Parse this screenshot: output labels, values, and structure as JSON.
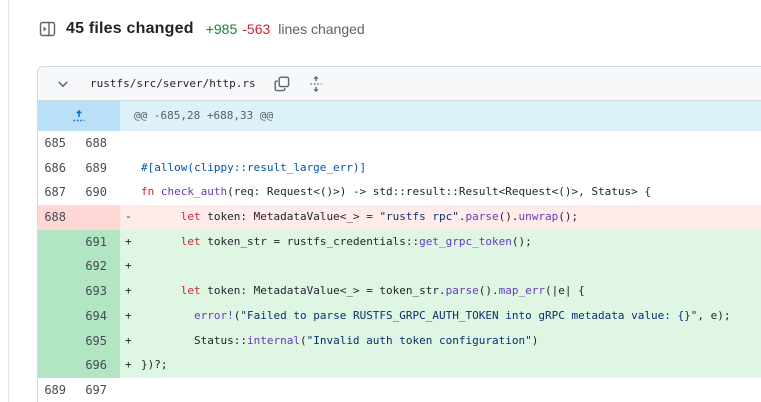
{
  "header": {
    "files_changed": "45 files changed",
    "additions": "+985",
    "deletions": "-563",
    "suffix": "lines changed"
  },
  "file": {
    "path": "rustfs/src/server/http.rs"
  },
  "colors": {
    "addition_text": "#1a7f37",
    "deletion_text": "#cf222e",
    "addition_line_bg": "#dff6e5",
    "addition_num_bg": "#b2e5c1",
    "deletion_line_bg": "#ffebe9",
    "deletion_num_bg": "#ffd7d5",
    "hunk_line_bg": "#ddf1fb",
    "hunk_num_bg": "#b9e0f7",
    "accent_blue": "#0969da"
  },
  "diff": {
    "hunk": "@@ -685,28 +688,33 @@",
    "rows": [
      {
        "old": "685",
        "new": "688",
        "type": "context",
        "marker": "",
        "code": []
      },
      {
        "old": "686",
        "new": "689",
        "type": "context",
        "marker": "",
        "code": [
          {
            "t": "#[allow(clippy::result_large_err)]",
            "c": "attr"
          }
        ]
      },
      {
        "old": "687",
        "new": "690",
        "type": "context",
        "marker": "",
        "code": [
          {
            "t": "fn ",
            "c": "kw"
          },
          {
            "t": "check_auth",
            "c": "fn"
          },
          {
            "t": "(req: Request<()>) -> std::result::Result<Request<()>, Status> {",
            "c": "pl"
          }
        ]
      },
      {
        "old": "688",
        "new": "",
        "type": "del",
        "marker": "-",
        "code": [
          {
            "t": "      ",
            "c": "pl"
          },
          {
            "t": "let",
            "c": "kw"
          },
          {
            "t": " token: MetadataValue<_> = ",
            "c": "pl"
          },
          {
            "t": "\"rustfs rpc\"",
            "c": "str"
          },
          {
            "t": ".",
            "c": "pl"
          },
          {
            "t": "parse",
            "c": "fn"
          },
          {
            "t": "().",
            "c": "pl"
          },
          {
            "t": "unwrap",
            "c": "fn"
          },
          {
            "t": "();",
            "c": "pl"
          }
        ]
      },
      {
        "old": "",
        "new": "691",
        "type": "add",
        "marker": "+",
        "code": [
          {
            "t": "      ",
            "c": "pl"
          },
          {
            "t": "let",
            "c": "kw"
          },
          {
            "t": " token_str = rustfs_credentials::",
            "c": "pl"
          },
          {
            "t": "get_grpc_token",
            "c": "fn"
          },
          {
            "t": "();",
            "c": "pl"
          }
        ]
      },
      {
        "old": "",
        "new": "692",
        "type": "add",
        "marker": "+",
        "code": []
      },
      {
        "old": "",
        "new": "693",
        "type": "add",
        "marker": "+",
        "code": [
          {
            "t": "      ",
            "c": "pl"
          },
          {
            "t": "let",
            "c": "kw"
          },
          {
            "t": " token: MetadataValue<_> = token_str.",
            "c": "pl"
          },
          {
            "t": "parse",
            "c": "fn"
          },
          {
            "t": "().",
            "c": "pl"
          },
          {
            "t": "map_err",
            "c": "fn"
          },
          {
            "t": "(|e| {",
            "c": "pl"
          }
        ]
      },
      {
        "old": "",
        "new": "694",
        "type": "add",
        "marker": "+",
        "code": [
          {
            "t": "        ",
            "c": "pl"
          },
          {
            "t": "error!",
            "c": "fn"
          },
          {
            "t": "(",
            "c": "pl"
          },
          {
            "t": "\"Failed to parse RUSTFS_GRPC_AUTH_TOKEN into gRPC metadata value: {}\"",
            "c": "str"
          },
          {
            "t": ", e);",
            "c": "pl"
          }
        ]
      },
      {
        "old": "",
        "new": "695",
        "type": "add",
        "marker": "+",
        "code": [
          {
            "t": "        ",
            "c": "pl"
          },
          {
            "t": "Status::",
            "c": "pl"
          },
          {
            "t": "internal",
            "c": "fn"
          },
          {
            "t": "(",
            "c": "pl"
          },
          {
            "t": "\"Invalid auth token configuration\"",
            "c": "str"
          },
          {
            "t": ")",
            "c": "pl"
          }
        ]
      },
      {
        "old": "",
        "new": "696",
        "type": "add",
        "marker": "+",
        "code": [
          {
            "t": "})?;",
            "c": "pl"
          }
        ]
      },
      {
        "old": "689",
        "new": "697",
        "type": "context",
        "marker": "",
        "code": []
      }
    ]
  }
}
